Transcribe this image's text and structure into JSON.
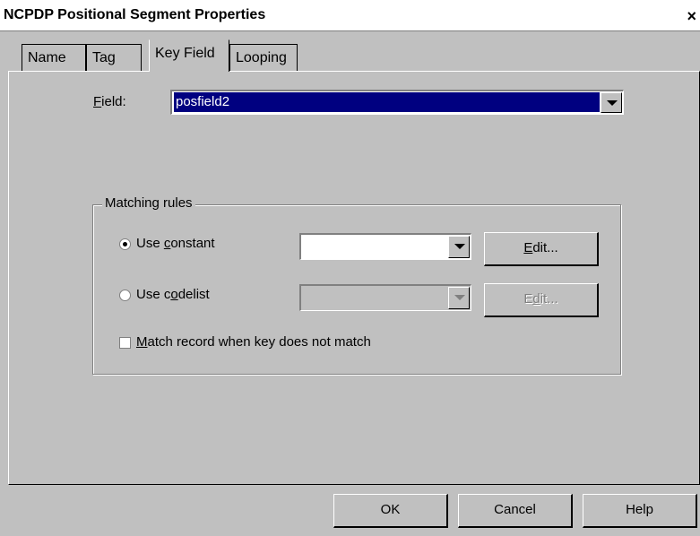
{
  "window": {
    "title": "NCPDP Positional Segment Properties",
    "close_glyph": "×"
  },
  "tabs": [
    {
      "label": "Name",
      "active": false
    },
    {
      "label": "Tag",
      "active": false
    },
    {
      "label": "Key Field",
      "active": true
    },
    {
      "label": "Looping",
      "active": false
    }
  ],
  "field": {
    "label_mnemonic": "F",
    "label_rest": "ield:",
    "value": "posfield2"
  },
  "matching_rules": {
    "legend": "Matching rules",
    "use_constant": {
      "label_pre": "Use ",
      "label_mnemonic": "c",
      "label_post": "onstant",
      "checked": true,
      "value": ""
    },
    "use_codelist": {
      "label_pre": "Use c",
      "label_mnemonic": "o",
      "label_post": "delist",
      "checked": false,
      "value": ""
    },
    "edit_constant": {
      "mnemonic": "E",
      "rest": "dit..."
    },
    "edit_codelist": {
      "pre": "E",
      "mnemonic": "d",
      "post": "it..."
    },
    "match_record": {
      "label_mnemonic": "M",
      "label_rest": "atch record when key does not match",
      "checked": false
    }
  },
  "buttons": {
    "ok": "OK",
    "cancel": "Cancel",
    "help": "Help"
  }
}
